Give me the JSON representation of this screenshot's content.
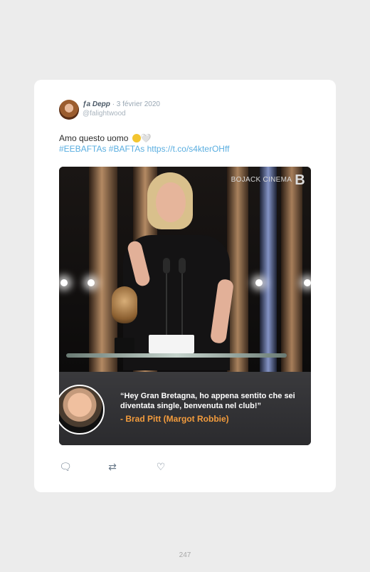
{
  "tweet": {
    "author_name": "ƒa Depp",
    "date": "· 3 février 2020",
    "handle": "@falightwood",
    "text": "Amo questo uomo",
    "emoji_laugh": "rolling-on-floor-laughing-emoji",
    "emoji_heart": "🤍",
    "links": "#EEBAFTAs #BAFTAs https://t.co/s4kterOHff"
  },
  "media": {
    "watermark": "BOJACK CINEMA",
    "watermark_logo": "B",
    "quote": "“Hey Gran Bretagna, ho appena sentito che sei  diventata single, benvenuta nel club!”",
    "attribution": "- Brad Pitt (Margot Robbie)"
  },
  "actions": {
    "reply_icon": "🗨",
    "retweet_icon": "⇄",
    "like_icon": "♡"
  },
  "colors": {
    "link": "#5aaee0",
    "attribution": "#f39c3d",
    "card": "#ffffff",
    "background": "#ececec"
  },
  "page": {
    "number": "247"
  }
}
